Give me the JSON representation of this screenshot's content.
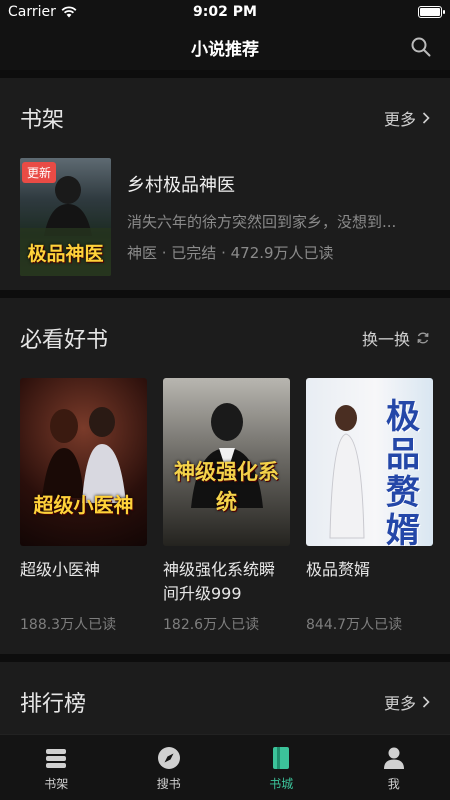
{
  "status_bar": {
    "carrier": "Carrier",
    "time": "9:02 PM"
  },
  "nav": {
    "title": "小说推荐"
  },
  "shelf": {
    "title": "书架",
    "more": "更多",
    "item": {
      "badge": "更新",
      "cover_text": "极品神医",
      "title": "乡村极品神医",
      "desc": "消失六年的徐方突然回到家乡，没想到...",
      "meta": "神医 · 已完结 · 472.9万人已读"
    }
  },
  "must_read": {
    "title": "必看好书",
    "action": "换一换",
    "books": [
      {
        "title": "超级小医神",
        "reads": "188.3万人已读",
        "cover_text": "超级小医神"
      },
      {
        "title": "神级强化系统瞬间升级999",
        "reads": "182.6万人已读",
        "cover_text": "神级强化系统"
      },
      {
        "title": "极品赘婿",
        "reads": "844.7万人已读",
        "cover_text": "极品赘婿"
      }
    ]
  },
  "ranking": {
    "title": "排行榜",
    "more": "更多"
  },
  "tabs": [
    {
      "label": "书架",
      "icon": "bookshelf-icon",
      "active": false
    },
    {
      "label": "搜书",
      "icon": "compass-icon",
      "active": false
    },
    {
      "label": "书城",
      "icon": "bookstore-icon",
      "active": true
    },
    {
      "label": "我",
      "icon": "user-icon",
      "active": false
    }
  ],
  "colors": {
    "accent": "#3cc39a",
    "badge": "#e94b45",
    "background": "#0d0d0d",
    "card": "#1c1c1c"
  }
}
